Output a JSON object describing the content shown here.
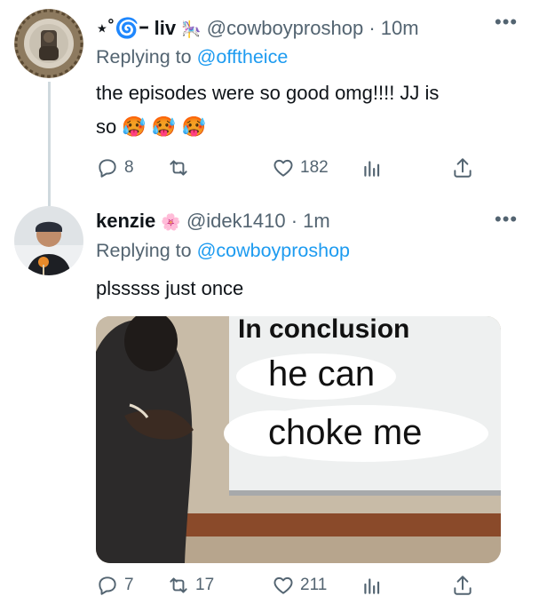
{
  "tweets": [
    {
      "display_name": "⋆˚🌀ｰ liv",
      "name_emoji": "🎠",
      "handle": "@cowboyproshop",
      "time": "10m",
      "replying_label": "Replying to",
      "replying_handle": "@offtheice",
      "text_line1": "the episodes were so good omg!!!! JJ is",
      "text_line2": "so",
      "text_emojis": [
        "🥵",
        "🥵",
        "🥵"
      ],
      "actions": {
        "reply": "8",
        "retweet": "",
        "like": "182"
      }
    },
    {
      "display_name": "kenzie",
      "name_emoji": "🌸",
      "handle": "@idek1410",
      "time": "1m",
      "replying_label": "Replying to",
      "replying_handle": "@cowboyproshop",
      "text_line1": "plsssss just once",
      "meme": {
        "heading": "In conclusion",
        "line1": "he can",
        "line2": "choke me"
      },
      "actions": {
        "reply": "7",
        "retweet": "17",
        "like": "211"
      }
    }
  ],
  "more_label": "•••"
}
